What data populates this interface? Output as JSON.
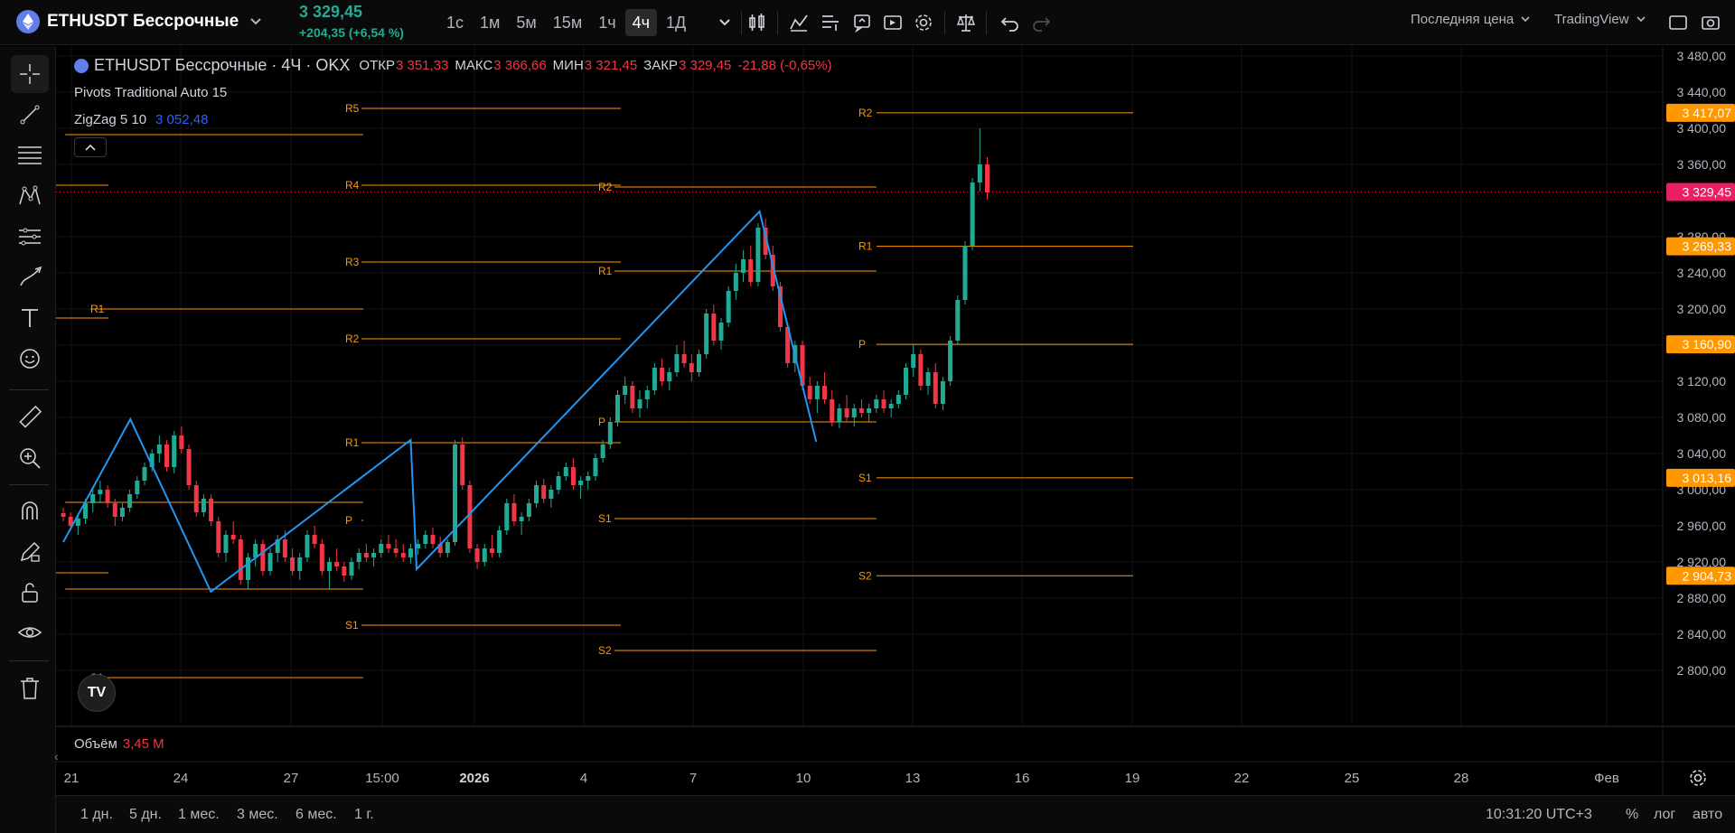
{
  "header": {
    "symbol": "ETHUSDT Бессрочные",
    "price": "3 329,45",
    "change": "+204,35 (+6,54 %)",
    "intervals": [
      "1с",
      "1м",
      "5м",
      "15м",
      "1ч",
      "4ч",
      "1Д"
    ],
    "active_interval": "4ч",
    "price_type": "Последняя цена",
    "brand": "TradingView"
  },
  "legend": {
    "title": "ETHUSDT Бессрочные · 4Ч · OKX",
    "open_label": "ОТКР",
    "open": "3 351,33",
    "high_label": "МАКС",
    "high": "3 366,66",
    "low_label": "МИН",
    "low": "3 321,45",
    "close_label": "ЗАКР",
    "close": "3 329,45",
    "change": "-21,88 (-0,65%)",
    "indicator1": "Pivots Traditional Auto 15",
    "indicator2_name": "ZigZag 5 10",
    "indicator2_value": "3 052,48"
  },
  "volume": {
    "label": "Объём",
    "value": "3,45 M"
  },
  "time_labels": [
    "21",
    "24",
    "27",
    "15:00",
    "2026",
    "4",
    "7",
    "10",
    "13",
    "16",
    "19",
    "22",
    "25",
    "28",
    "Фев"
  ],
  "ranges": [
    "1 дн.",
    "5 дн.",
    "1 мес.",
    "3 мес.",
    "6 мес.",
    "1 г."
  ],
  "clock": "10:31:20 UTC+3",
  "scale_buttons": [
    "%",
    "лог",
    "авто"
  ],
  "logo_text": "TV",
  "colors": {
    "up": "#22ab94",
    "down": "#f23645",
    "pivot": "#ff9800",
    "zigzag": "#2196f3",
    "price_tag": "#e91e63"
  },
  "chart_data": {
    "type": "candlestick",
    "y_ticks": [
      3480,
      3440,
      3400,
      3360,
      3280,
      3240,
      3200,
      3160,
      3120,
      3080,
      3040,
      3000,
      2960,
      2920,
      2880,
      2840,
      2800
    ],
    "ylim": [
      2780,
      3500
    ],
    "current_price": 3329.45,
    "pivot_levels": [
      {
        "label": "R2",
        "value": 3417.07
      },
      {
        "label": "R1",
        "value": 3269.33
      },
      {
        "label": "P",
        "value": 3160.9
      },
      {
        "label": "S1",
        "value": 3013.16
      },
      {
        "label": "S2",
        "value": 2904.73
      }
    ],
    "price_tags": [
      "3 417,07",
      "3 329,45",
      "3 269,33",
      "3 160,90",
      "3 013,16",
      "2 904,73"
    ],
    "zigzag": [
      [
        0,
        2942
      ],
      [
        45,
        3078
      ],
      [
        99,
        2887
      ],
      [
        233,
        3055
      ],
      [
        237,
        2912
      ],
      [
        467,
        3308
      ],
      [
        505,
        3053
      ]
    ],
    "candles": [
      [
        2974,
        2980,
        2965,
        2970
      ],
      [
        2970,
        2975,
        2955,
        2960
      ],
      [
        2960,
        2972,
        2950,
        2968
      ],
      [
        2968,
        2990,
        2962,
        2985
      ],
      [
        2985,
        3000,
        2975,
        2995
      ],
      [
        2995,
        3010,
        2985,
        3000
      ],
      [
        3000,
        3005,
        2980,
        2985
      ],
      [
        2985,
        2990,
        2960,
        2970
      ],
      [
        2970,
        2985,
        2965,
        2980
      ],
      [
        2980,
        3000,
        2975,
        2995
      ],
      [
        2995,
        3015,
        2990,
        3010
      ],
      [
        3010,
        3030,
        3005,
        3025
      ],
      [
        3025,
        3045,
        3020,
        3040
      ],
      [
        3040,
        3060,
        3030,
        3050
      ],
      [
        3050,
        3055,
        3020,
        3025
      ],
      [
        3025,
        3065,
        3018,
        3060
      ],
      [
        3060,
        3070,
        3040,
        3045
      ],
      [
        3045,
        3050,
        3000,
        3005
      ],
      [
        3005,
        3010,
        2970,
        2975
      ],
      [
        2975,
        2995,
        2970,
        2990
      ],
      [
        2990,
        2995,
        2960,
        2965
      ],
      [
        2965,
        2970,
        2925,
        2930
      ],
      [
        2930,
        2955,
        2920,
        2950
      ],
      [
        2950,
        2965,
        2940,
        2945
      ],
      [
        2945,
        2950,
        2895,
        2900
      ],
      [
        2900,
        2930,
        2890,
        2925
      ],
      [
        2925,
        2945,
        2915,
        2940
      ],
      [
        2940,
        2945,
        2905,
        2910
      ],
      [
        2910,
        2935,
        2905,
        2930
      ],
      [
        2930,
        2950,
        2920,
        2945
      ],
      [
        2945,
        2955,
        2920,
        2925
      ],
      [
        2925,
        2935,
        2905,
        2910
      ],
      [
        2910,
        2930,
        2900,
        2925
      ],
      [
        2925,
        2955,
        2920,
        2950
      ],
      [
        2950,
        2960,
        2935,
        2940
      ],
      [
        2940,
        2945,
        2905,
        2910
      ],
      [
        2910,
        2925,
        2890,
        2920
      ],
      [
        2920,
        2935,
        2910,
        2915
      ],
      [
        2915,
        2920,
        2898,
        2905
      ],
      [
        2905,
        2925,
        2900,
        2920
      ],
      [
        2920,
        2935,
        2912,
        2930
      ],
      [
        2930,
        2940,
        2920,
        2925
      ],
      [
        2925,
        2935,
        2915,
        2930
      ],
      [
        2930,
        2945,
        2925,
        2940
      ],
      [
        2940,
        2950,
        2930,
        2935
      ],
      [
        2935,
        2945,
        2925,
        2930
      ],
      [
        2930,
        2940,
        2920,
        2925
      ],
      [
        2925,
        2940,
        2918,
        2935
      ],
      [
        2935,
        2945,
        2928,
        2940
      ],
      [
        2940,
        2955,
        2935,
        2950
      ],
      [
        2950,
        2958,
        2935,
        2940
      ],
      [
        2940,
        2948,
        2925,
        2930
      ],
      [
        2930,
        2945,
        2925,
        2942
      ],
      [
        2942,
        3055,
        2938,
        3050
      ],
      [
        3050,
        3058,
        3000,
        3005
      ],
      [
        3005,
        3010,
        2930,
        2935
      ],
      [
        2935,
        2940,
        2912,
        2920
      ],
      [
        2920,
        2940,
        2915,
        2935
      ],
      [
        2935,
        2950,
        2925,
        2930
      ],
      [
        2930,
        2960,
        2925,
        2955
      ],
      [
        2955,
        2990,
        2950,
        2985
      ],
      [
        2985,
        2995,
        2960,
        2965
      ],
      [
        2965,
        2975,
        2950,
        2970
      ],
      [
        2970,
        2990,
        2965,
        2985
      ],
      [
        2985,
        3010,
        2980,
        3005
      ],
      [
        3005,
        3012,
        2985,
        2990
      ],
      [
        2990,
        3005,
        2980,
        3000
      ],
      [
        3000,
        3020,
        2995,
        3015
      ],
      [
        3015,
        3030,
        3010,
        3025
      ],
      [
        3025,
        3035,
        3000,
        3005
      ],
      [
        3005,
        3015,
        2990,
        3010
      ],
      [
        3010,
        3020,
        3000,
        3015
      ],
      [
        3015,
        3040,
        3010,
        3035
      ],
      [
        3035,
        3055,
        3030,
        3050
      ],
      [
        3050,
        3080,
        3045,
        3075
      ],
      [
        3075,
        3110,
        3070,
        3105
      ],
      [
        3105,
        3125,
        3095,
        3115
      ],
      [
        3115,
        3120,
        3085,
        3090
      ],
      [
        3090,
        3110,
        3080,
        3100
      ],
      [
        3100,
        3115,
        3090,
        3110
      ],
      [
        3110,
        3140,
        3105,
        3135
      ],
      [
        3135,
        3145,
        3115,
        3120
      ],
      [
        3120,
        3135,
        3110,
        3130
      ],
      [
        3130,
        3160,
        3125,
        3150
      ],
      [
        3150,
        3165,
        3135,
        3140
      ],
      [
        3140,
        3150,
        3120,
        3130
      ],
      [
        3130,
        3155,
        3125,
        3150
      ],
      [
        3150,
        3200,
        3145,
        3195
      ],
      [
        3195,
        3205,
        3160,
        3165
      ],
      [
        3165,
        3190,
        3155,
        3185
      ],
      [
        3185,
        3225,
        3180,
        3220
      ],
      [
        3220,
        3250,
        3210,
        3240
      ],
      [
        3240,
        3265,
        3230,
        3255
      ],
      [
        3255,
        3270,
        3225,
        3230
      ],
      [
        3230,
        3295,
        3225,
        3290
      ],
      [
        3290,
        3300,
        3255,
        3260
      ],
      [
        3260,
        3270,
        3220,
        3225
      ],
      [
        3225,
        3230,
        3175,
        3180
      ],
      [
        3180,
        3185,
        3135,
        3140
      ],
      [
        3140,
        3165,
        3130,
        3160
      ],
      [
        3160,
        3165,
        3110,
        3115
      ],
      [
        3115,
        3125,
        3095,
        3100
      ],
      [
        3100,
        3120,
        3085,
        3115
      ],
      [
        3115,
        3130,
        3095,
        3100
      ],
      [
        3100,
        3110,
        3070,
        3075
      ],
      [
        3075,
        3095,
        3068,
        3090
      ],
      [
        3090,
        3105,
        3075,
        3080
      ],
      [
        3080,
        3095,
        3070,
        3090
      ],
      [
        3090,
        3100,
        3080,
        3085
      ],
      [
        3085,
        3095,
        3075,
        3090
      ],
      [
        3090,
        3105,
        3085,
        3100
      ],
      [
        3100,
        3110,
        3085,
        3090
      ],
      [
        3090,
        3100,
        3080,
        3095
      ],
      [
        3095,
        3110,
        3090,
        3105
      ],
      [
        3105,
        3140,
        3100,
        3135
      ],
      [
        3135,
        3160,
        3125,
        3150
      ],
      [
        3150,
        3155,
        3110,
        3115
      ],
      [
        3115,
        3135,
        3105,
        3130
      ],
      [
        3130,
        3140,
        3090,
        3095
      ],
      [
        3095,
        3125,
        3088,
        3120
      ],
      [
        3120,
        3170,
        3115,
        3165
      ],
      [
        3165,
        3215,
        3160,
        3210
      ],
      [
        3210,
        3275,
        3205,
        3270
      ],
      [
        3270,
        3345,
        3265,
        3340
      ],
      [
        3340,
        3400,
        3330,
        3360
      ],
      [
        3360,
        3368,
        3321,
        3329
      ]
    ]
  }
}
